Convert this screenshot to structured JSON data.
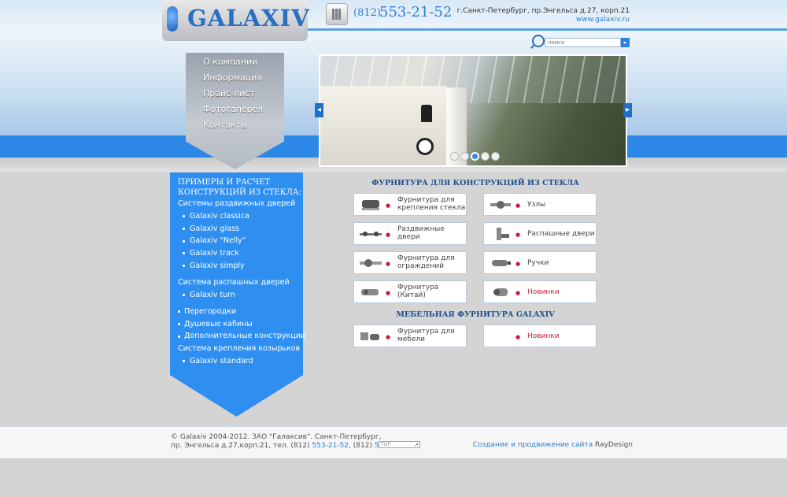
{
  "header": {
    "logo": "GALAXIV",
    "phone_code": "(812)",
    "phone_number": "553-21-52",
    "address": "г.Санкт-Петербург, пр.Энгельса д.27, корп.21",
    "site": "www.galaxiv.ru",
    "search_placeholder": "поиск",
    "search_button": "▸"
  },
  "menu": [
    "О компании",
    "Информация",
    "Прайс-лист",
    "Фотогалерея",
    "Контакты"
  ],
  "slider": {
    "prev": "◂",
    "next": "▸",
    "dot_count": 5,
    "active_dot": 3
  },
  "sidebar": {
    "title_line1": "ПРИМЕРЫ И РАСЧЕТ",
    "title_line2": "КОНСТРУКЦИЙ ИЗ СТЕКЛА:",
    "sliding_doors": "Системы раздвижных дверей",
    "sliding_items": [
      "Galaxiv classica",
      "Galaxiv glass",
      "Galaxiv \"Nelly\"",
      "Galaxiv track",
      "Galaxiv simply"
    ],
    "swing_doors": "Система распашных дверей",
    "swing_items": [
      "Galaxiv turn"
    ],
    "partitions": "Перегородки",
    "showers": "Душевые кабины",
    "additional": "Дополнительные конструкции",
    "canopy": "Система крепления козырьков",
    "canopy_items": [
      "Galaxiv standard"
    ]
  },
  "catalog": {
    "title": "ФУРНИТУРА ДЛЯ КОНСТРУКЦИЙ ИЗ СТЕКЛА",
    "furniture_title": "МЕБЕЛЬНАЯ ФУРНИТУРА GALAXIV",
    "cards": [
      {
        "line1": "Фурнитура для",
        "line2": "крепления стекла",
        "icon": "glass-clamp-icon"
      },
      {
        "line1": "Узлы",
        "line2": "",
        "icon": "joint-icon"
      },
      {
        "line1": "Раздвижные",
        "line2": "двери",
        "icon": "sliding-rail-icon"
      },
      {
        "line1": "Распашные двери",
        "line2": "",
        "icon": "hinge-icon"
      },
      {
        "line1": "Фурнитура для",
        "line2": "ограждений",
        "icon": "railing-fitting-icon"
      },
      {
        "line1": "Ручки",
        "line2": "",
        "icon": "handle-icon"
      },
      {
        "line1": "Фурнитура",
        "line2": "(Китай)",
        "icon": "china-fitting-icon"
      },
      {
        "line1": "Новинки",
        "line2": "",
        "icon": "new-items-icon"
      },
      {
        "line1": "Фурнитура для",
        "line2": "мебели",
        "icon": "furniture-fitting-icon"
      },
      {
        "line1": "Новинки",
        "line2": "",
        "icon": ""
      }
    ]
  },
  "footer": {
    "copy_line1": "© Galaxiv 2004-2012. ЗАО \"Галаксив\". Санкт-Петербург,",
    "copy_line2_a": "пр. Энгельса д.27,корп.21, тел. (812) ",
    "phone1": "553-21-52",
    "copy_line2_b": ", (812) ",
    "phone2": "553-34-51",
    "counter": "TOP",
    "credit_link": "Создание и продвижение сайта",
    "credit_company": " RayDesign"
  },
  "colors": {
    "accent": "#2c88e6",
    "brand": "#2a6fc0",
    "new": "#c0213a"
  }
}
